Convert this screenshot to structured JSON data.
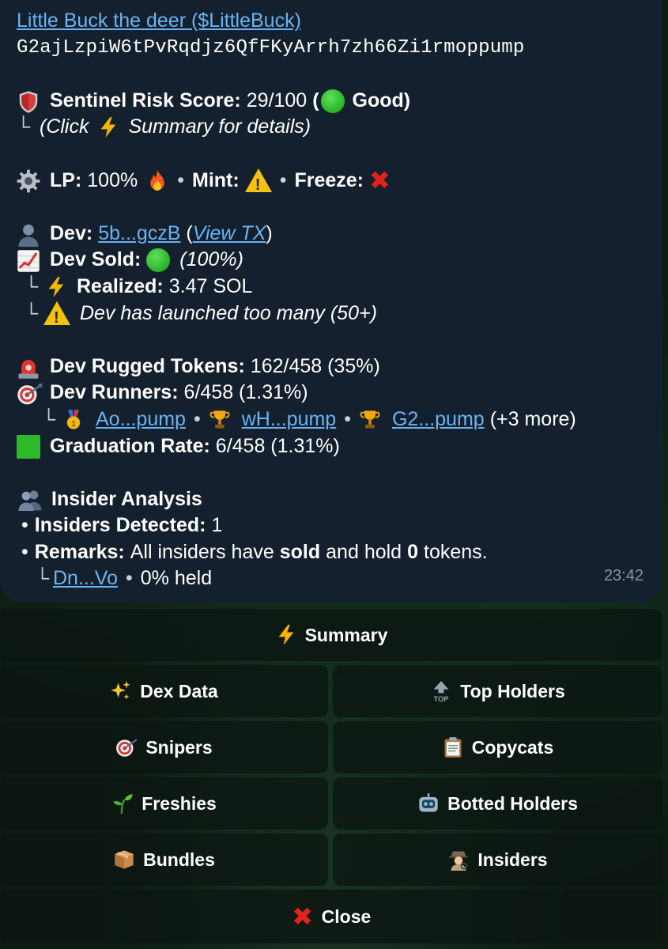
{
  "message": {
    "title_link": "Little Buck the deer ($LittleBuck)",
    "contract": "G2ajLzpiW6tPvRqdjz6QfFKyArrh7zh66Zi1rmoppump",
    "risk": {
      "label": "Sentinel Risk Score:",
      "value": "29/100",
      "open": "(",
      "status": "Good)",
      "hint_prefix": "(Click",
      "hint_suffix": "Summary for details)"
    },
    "flags": {
      "lp_label": "LP:",
      "lp_value": "100%",
      "mint_label": "Mint:",
      "freeze_label": "Freeze:",
      "sep": "•"
    },
    "dev": {
      "label": "Dev:",
      "address": "5b...gczB",
      "paren_open": "(",
      "view_tx": "View TX",
      "paren_close": ")",
      "sold_label": "Dev Sold:",
      "sold_pct": "(100%)",
      "realized_label": "Realized:",
      "realized_value": "3.47 SOL",
      "warning": "Dev has launched too many (50+)"
    },
    "stats": {
      "rugged_label": "Dev Rugged Tokens:",
      "rugged_value": "162/458 (35%)",
      "runners_label": "Dev Runners:",
      "runners_value": "6/458 (1.31%)",
      "runners": [
        "Ao...pump",
        "wH...pump",
        "G2...pump"
      ],
      "runners_more": "(+3 more)",
      "grad_label": "Graduation Rate:",
      "grad_value": "6/458 (1.31%)"
    },
    "insider": {
      "title": "Insider Analysis",
      "bullet": "•",
      "detected_label": "Insiders Detected:",
      "detected_value": "1",
      "remarks_label": "Remarks:",
      "remarks_1": "All insiders have",
      "remarks_sold": "sold",
      "remarks_2": "and hold",
      "remarks_zero": "0",
      "remarks_3": "tokens.",
      "address": "Dn...Vo",
      "held": "0% held"
    },
    "time": "23:42"
  },
  "keyboard": {
    "summary": "Summary",
    "dex_data": "Dex Data",
    "top_holders": "Top Holders",
    "top_badge": "TOP",
    "snipers": "Snipers",
    "copycats": "Copycats",
    "freshies": "Freshies",
    "botted_holders": "Botted Holders",
    "bundles": "Bundles",
    "insiders": "Insiders",
    "close": "Close"
  },
  "icons": [
    "shield-icon",
    "green-circle-icon",
    "lightning-icon",
    "gear-icon",
    "fire-icon",
    "warning-icon",
    "red-x-icon",
    "person-icon",
    "chart-up-icon",
    "siren-icon",
    "dart-icon",
    "medal-icon",
    "trophy-icon",
    "green-square-icon",
    "people-icon",
    "sparkles-icon",
    "top-arrow-icon",
    "clipboard-icon",
    "seedling-icon",
    "robot-icon",
    "package-icon",
    "detective-icon"
  ],
  "colors": {
    "link": "#6ab3f3",
    "bubble": "#14202d",
    "button": "#0c1612",
    "good": "#12a10f",
    "danger": "#e0241d",
    "warn": "#f4c20d"
  }
}
